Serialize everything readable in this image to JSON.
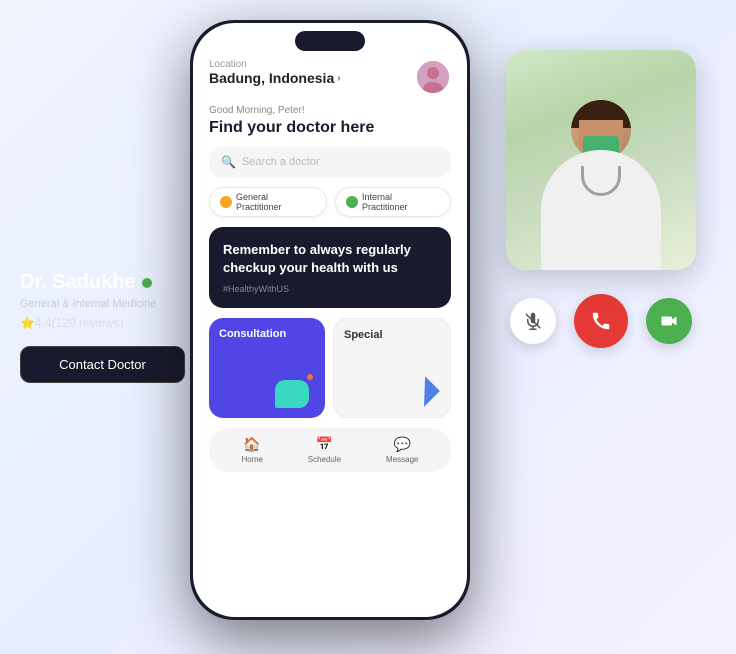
{
  "left_panel": {
    "doctor_name": "Dr. Sadukhe",
    "online_status": "online",
    "specialty": "General & Internal Medicine",
    "rating_emoji": "⭐",
    "rating_value": "4.4",
    "review_count": "120 reviews",
    "rating_text": "⭐4.4(120 reviews)",
    "contact_button_label": "Contact Doctor"
  },
  "phone": {
    "location_label": "Location",
    "location_value": "Badung, Indonesia",
    "location_arrow": "›",
    "greeting": "Good Morning, Peter!",
    "main_heading": "Find your doctor here",
    "search_placeholder": "Search a doctor",
    "categories": [
      {
        "label": "General Practitioner",
        "color": "#f5a623"
      },
      {
        "label": "Internal Practitioner",
        "color": "#4caf50"
      }
    ],
    "banner": {
      "title": "Remember to always regularly checkup your health with us",
      "hashtag": "#HealthyWithUS"
    },
    "services": [
      {
        "key": "consultation",
        "label": "Consultation",
        "type": "consultation"
      },
      {
        "key": "special",
        "label": "Special",
        "type": "special"
      }
    ],
    "nav_items": [
      {
        "label": "Home",
        "icon": "🏠"
      },
      {
        "label": "Schedule",
        "icon": "📅"
      },
      {
        "label": "Message",
        "icon": "💬"
      }
    ]
  },
  "video_call": {
    "controls": [
      {
        "key": "mute",
        "label": "Mute",
        "icon": "🎤"
      },
      {
        "key": "hangup",
        "label": "End Call",
        "icon": "📞"
      },
      {
        "key": "video",
        "label": "Camera",
        "icon": "🎥"
      }
    ]
  }
}
